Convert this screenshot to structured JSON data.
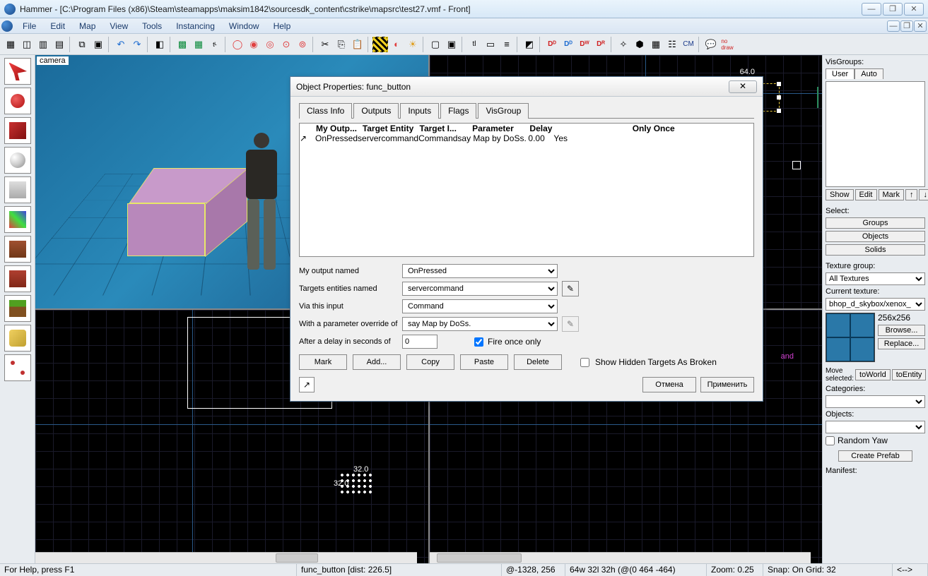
{
  "titlebar": {
    "text": "Hammer - [C:\\Program Files (x86)\\Steam\\steamapps\\maksim1842\\sourcesdk_content\\cstrike\\mapsrc\\test27.vmf - Front]"
  },
  "menu": [
    "File",
    "Edit",
    "Map",
    "View",
    "Tools",
    "Instancing",
    "Window",
    "Help"
  ],
  "viewport": {
    "camera_label": "camera",
    "grid_lbl_64": "64.0",
    "grid_lbl_32": "32.0",
    "ent_label": "and",
    "seltext_32a": "32.0",
    "seltext_32b": "32.0"
  },
  "dialog": {
    "title": "Object Properties: func_button",
    "tabs": [
      "Class Info",
      "Outputs",
      "Inputs",
      "Flags",
      "VisGroup"
    ],
    "active_tab": 1,
    "table": {
      "headers": [
        "",
        "My Outp...",
        "Target Entity",
        "Target I...",
        "Parameter",
        "Delay",
        "Only Once"
      ],
      "row": {
        "output": "OnPressed",
        "target": "servercommand",
        "input": "Command",
        "param": "say Map by DoSs.",
        "delay": "0.00",
        "once": "Yes"
      }
    },
    "form": {
      "lbl_output": "My output named",
      "val_output": "OnPressed",
      "lbl_target": "Targets entities named",
      "val_target": "servercommand",
      "lbl_input": "Via this input",
      "val_input": "Command",
      "lbl_param": "With a parameter override of",
      "val_param": "say Map by DoSs.",
      "lbl_delay": "After a delay in seconds of",
      "val_delay": "0",
      "fire_once": "Fire once only",
      "fire_once_checked": true
    },
    "buttons": {
      "mark": "Mark",
      "add": "Add...",
      "copy": "Copy",
      "paste": "Paste",
      "delete": "Delete",
      "hidden_broken": "Show Hidden Targets As Broken",
      "cancel": "Отмена",
      "apply": "Применить"
    }
  },
  "right": {
    "visgroups_lbl": "VisGroups:",
    "tab_user": "User",
    "tab_auto": "Auto",
    "btn_show": "Show",
    "btn_edit": "Edit",
    "btn_mark": "Mark",
    "up": "↑",
    "dn": "↓",
    "select_lbl": "Select:",
    "groups": "Groups",
    "objects": "Objects",
    "solids": "Solids",
    "texgrp_lbl": "Texture group:",
    "texgrp_val": "All Textures",
    "curtex_lbl": "Current texture:",
    "curtex_val": "bhop_d_skybox/xenox_",
    "tex_size": "256x256",
    "browse": "Browse...",
    "replace": "Replace...",
    "move_lbl": "Move selected:",
    "toworld": "toWorld",
    "toentity": "toEntity",
    "cat_lbl": "Categories:",
    "obj_lbl": "Objects:",
    "randomyaw": "Random Yaw",
    "create_prefab": "Create Prefab",
    "manifest_lbl": "Manifest:"
  },
  "status": {
    "help": "For Help, press F1",
    "entity": "func_button   [dist: 226.5]",
    "coords": "@-1328, 256",
    "dims": "64w 32l 32h (@(0 464 -464)",
    "zoom": "Zoom: 0.25",
    "snap": "Snap: On Grid: 32",
    "arrows": "<-->"
  }
}
